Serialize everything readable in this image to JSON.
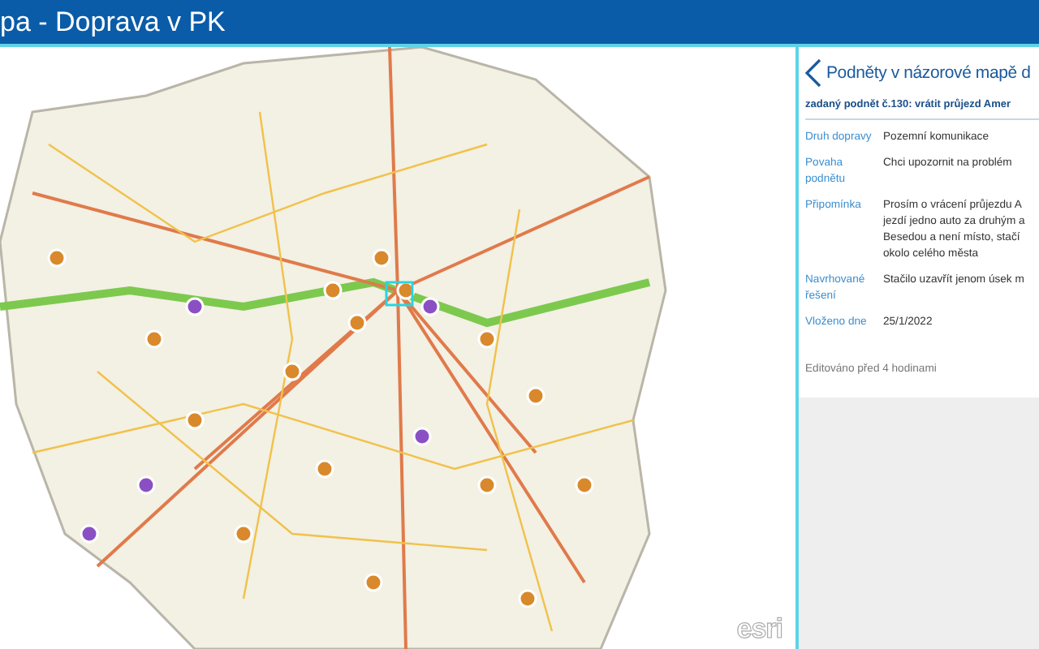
{
  "header": {
    "title": "pa - Doprava v PK"
  },
  "map": {
    "attribution": "esri"
  },
  "panel": {
    "title": "Podněty v názorové mapě d",
    "subtitle": "zadaný podnět č.130: vrátit průjezd Amer",
    "fields": [
      {
        "label": "Druh dopravy",
        "lines": [
          "Pozemní komunikace"
        ]
      },
      {
        "label": "Povaha podnětu",
        "lines": [
          "Chci upozornit na problém"
        ]
      },
      {
        "label": "Připomínka",
        "lines": [
          "Prosím o vrácení průjezdu A",
          "jezdí jedno auto za druhým a",
          "Besedou a není místo, stačí",
          "okolo celého města"
        ]
      },
      {
        "label": "Navrhované řešení",
        "lines": [
          "Stačilo uzavřít jenom úsek m"
        ]
      },
      {
        "label": "Vloženo dne",
        "lines": [
          "25/1/2022"
        ]
      }
    ],
    "edited": "Editováno před 4 hodinami"
  }
}
